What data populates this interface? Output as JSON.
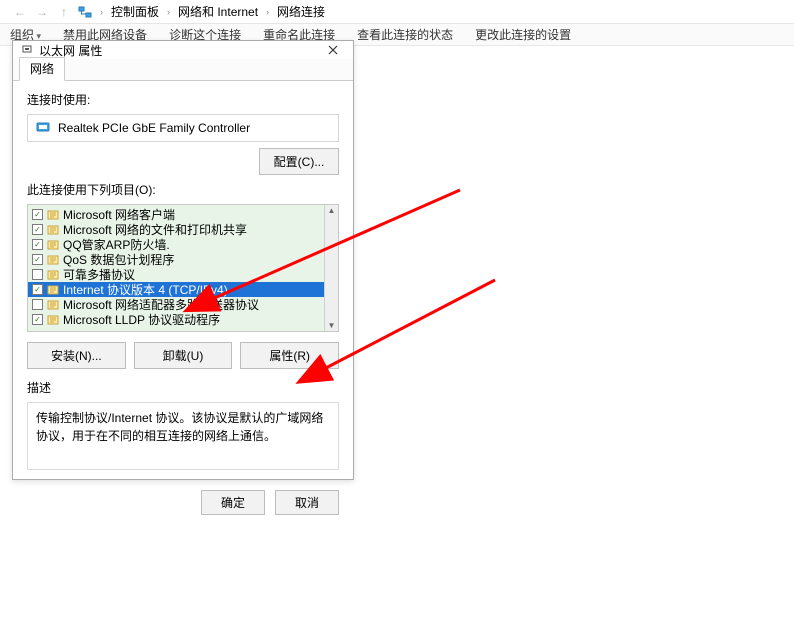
{
  "explorer": {
    "crumbs": [
      "控制面板",
      "网络和 Internet",
      "网络连接"
    ]
  },
  "cmdbar": {
    "org": "组织",
    "disable": "禁用此网络设备",
    "diagnose": "诊断这个连接",
    "rename": "重命名此连接",
    "status": "查看此连接的状态",
    "change": "更改此连接的设置"
  },
  "dialog": {
    "title": "以太网 属性",
    "tab": "网络",
    "connect_using": "连接时使用:",
    "adapter": "Realtek PCIe GbE Family Controller",
    "configure": "配置(C)...",
    "items_label": "此连接使用下列项目(O):",
    "items": [
      {
        "label": "Microsoft 网络客户端",
        "checked": true,
        "selected": false
      },
      {
        "label": "Microsoft 网络的文件和打印机共享",
        "checked": true,
        "selected": false
      },
      {
        "label": "QQ管家ARP防火墙.",
        "checked": true,
        "selected": false
      },
      {
        "label": "QoS 数据包计划程序",
        "checked": true,
        "selected": false
      },
      {
        "label": "可靠多播协议",
        "checked": false,
        "selected": false
      },
      {
        "label": "Internet 协议版本 4 (TCP/IPv4)",
        "checked": true,
        "selected": true
      },
      {
        "label": "Microsoft 网络适配器多路传送器协议",
        "checked": false,
        "selected": false
      },
      {
        "label": "Microsoft LLDP 协议驱动程序",
        "checked": true,
        "selected": false
      }
    ],
    "install": "安装(N)...",
    "uninstall": "卸载(U)",
    "properties": "属性(R)",
    "desc_label": "描述",
    "desc": "传输控制协议/Internet 协议。该协议是默认的广域网络协议，用于在不同的相互连接的网络上通信。",
    "ok": "确定",
    "cancel": "取消"
  }
}
